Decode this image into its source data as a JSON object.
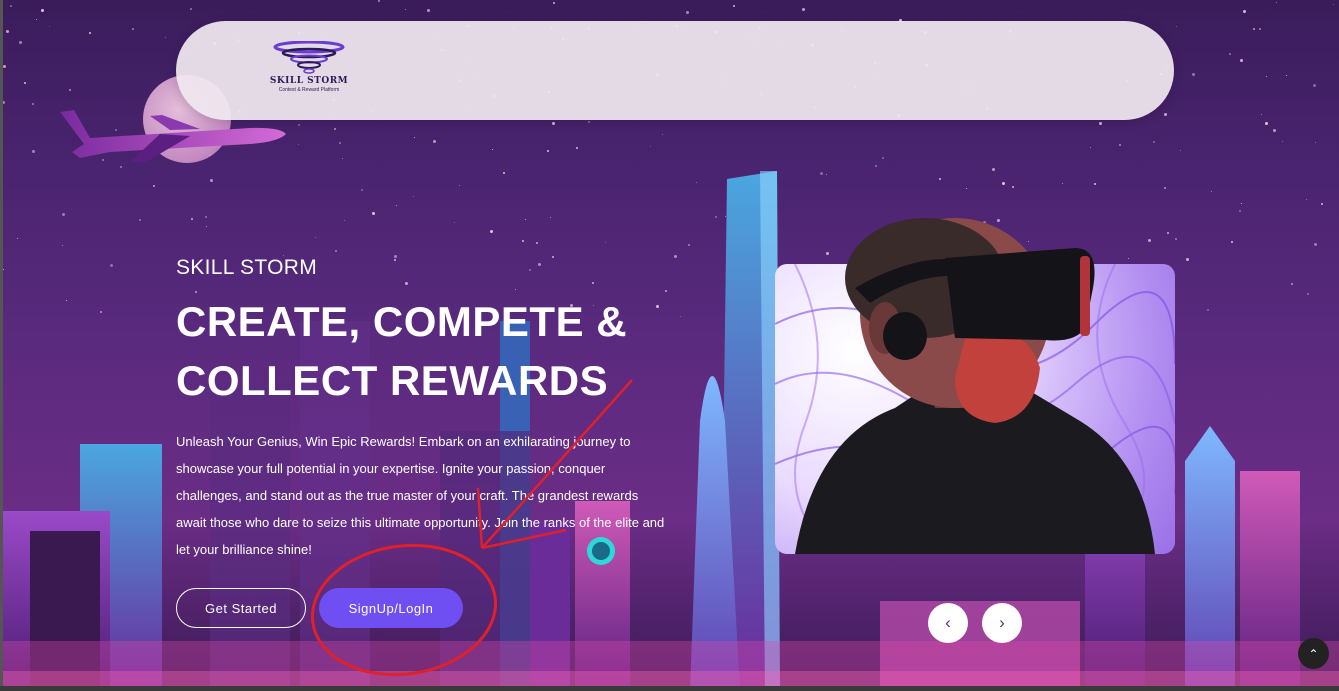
{
  "header": {
    "logo_title": "SKILL STORM",
    "logo_subtitle": "Contest & Reward Platform"
  },
  "hero": {
    "eyebrow": "SKILL STORM",
    "headline_line1": "CREATE, COMPETE &",
    "headline_line2": "COLLECT REWARDS",
    "description": "Unleash Your Genius, Win Epic Rewards! Embark on an exhilarating journey to showcase your full potential in your expertise. Ignite your passion, conquer challenges, and stand out as the true master of your craft. The grandest rewards await those who dare to seize this ultimate opportunity. Join the ranks of the elite and let your brilliance shine!",
    "get_started_label": "Get Started",
    "signup_label": "SignUp/LogIn"
  },
  "carousel": {
    "prev_label": "‹",
    "next_label": "›"
  },
  "scroll_top": {
    "label": "⌃"
  },
  "colors": {
    "accent": "#6f4ef2",
    "annotation": "#e0202a"
  }
}
